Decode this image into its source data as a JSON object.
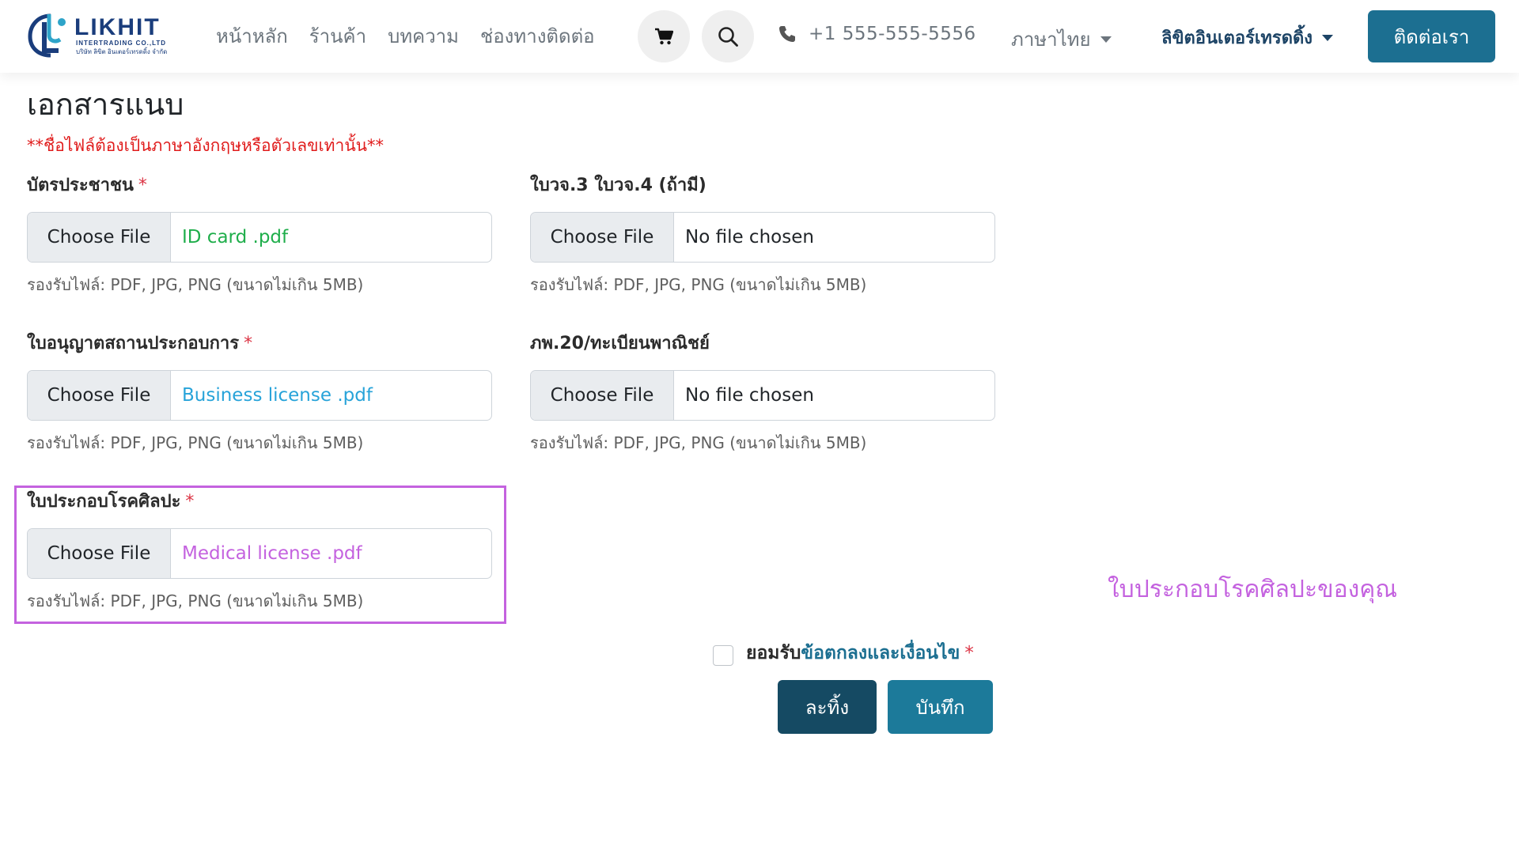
{
  "navbar": {
    "logo": {
      "word": "LIKHIT",
      "sub": "INTERTRADING CO.,LTD",
      "thai": "บริษัท ลิขิต อินเตอร์เทรดดิ้ง จำกัด"
    },
    "menu": [
      "หน้าหลัก",
      "ร้านค้า",
      "บทความ",
      "ช่องทางติดต่อ"
    ],
    "phone": "+1 555-555-5556",
    "language": "ภาษาไทย",
    "company": "ลิขิตอินเตอร์เทรดดิ้ง",
    "contact_button": "ติดต่อเรา",
    "icons": {
      "cart": "cart-icon",
      "search": "search-icon",
      "phone": "phone-icon"
    }
  },
  "form": {
    "title": "เอกสารแนบ",
    "warning": "**ชื่อไฟล์ต้องเป็นภาษาอังกฤษหรือตัวเลขเท่านั้น**",
    "required_mark": "*",
    "choose_label": "Choose File",
    "fields": [
      {
        "label": "บัตรประชาชน",
        "required": true,
        "file": "ID card .pdf",
        "file_color": "#1fae4b",
        "help": "รองรับไฟล์: PDF, JPG, PNG (ขนาดไม่เกิน 5MB)"
      },
      {
        "label": "ใบวจ.3 ใบวจ.4 (ถ้ามี)",
        "required": false,
        "file": "No file chosen",
        "file_color": "#212529",
        "help": "รองรับไฟล์: PDF, JPG, PNG (ขนาดไม่เกิน 5MB)"
      },
      {
        "label": "ใบอนุญาตสถานประกอบการ",
        "required": true,
        "file": "Business license .pdf",
        "file_color": "#27a3d9",
        "help": "รองรับไฟล์: PDF, JPG, PNG (ขนาดไม่เกิน 5MB)"
      },
      {
        "label": "ภพ.20/ทะเบียนพาณิชย์",
        "required": false,
        "file": "No file chosen",
        "file_color": "#212529",
        "help": "รองรับไฟล์: PDF, JPG, PNG (ขนาดไม่เกิน 5MB)"
      },
      {
        "label": "ใบประกอบโรคศิลปะ",
        "required": true,
        "file": "Medical license .pdf",
        "file_color": "#c462df",
        "help": "รองรับไฟล์: PDF, JPG, PNG (ขนาดไม่เกิน 5MB)"
      }
    ],
    "annotation": "ใบประกอบโรคศิลปะของคุณ",
    "terms_prefix": "ยอมรับ",
    "terms_link": "ข้อตกลงและเงื่อนไข",
    "discard_button": "ละทิ้ง",
    "save_button": "บันทึก"
  },
  "colors": {
    "primary": "#1c6f91",
    "dark_primary": "#154a63",
    "warning": "#e01b1b",
    "highlight": "#c462df"
  }
}
